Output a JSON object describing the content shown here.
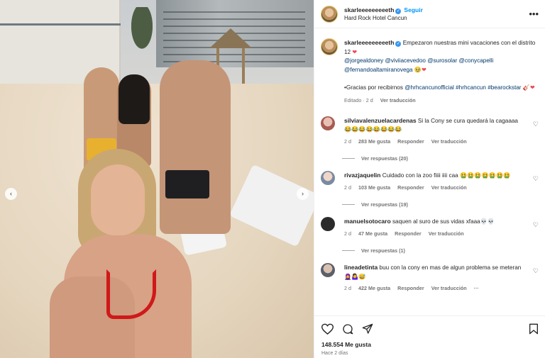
{
  "post": {
    "username": "skarleeeeeeeeeth",
    "follow_label": "Seguir",
    "location": "Hard Rock Hotel Cancun",
    "caption": {
      "p1": "Empezaron nuestras mini vacaciones con el distrito 12",
      "mentions": [
        "@jorgealdoney",
        "@viviiacevedoo",
        "@surosolar",
        "@conycapelli",
        "@fernandoaltamiranovega"
      ],
      "p2": "•Gracias por recibirnos",
      "p2_mentions": [
        "@hrhcancunofficial",
        "#hrhcancun",
        "#bearockstar"
      ],
      "time": "Editado · 2 d",
      "see_translation": "Ver traducción"
    },
    "likes": "148.554 Me gusta",
    "posted_ago": "Hace 2 días"
  },
  "comments": [
    {
      "user": "silviavalenzuelacardenas",
      "text": "Si la Cony se cura quedará la cagaaaa",
      "emoji": "😂😂😂😂😂😂😂😂",
      "time": "2 d",
      "likes": "283 Me gusta",
      "reply": "Responder",
      "translate": "Ver traducción",
      "replies": "Ver respuestas (20)"
    },
    {
      "user": "rivazjaquelin",
      "text": "Cuidado con la zoo fiiii iiii caa",
      "emoji": "🤮🤮🤮🤮🤮🤮🤮",
      "time": "2 d",
      "likes": "103 Me gusta",
      "reply": "Responder",
      "translate": "Ver traducción",
      "replies": "Ver respuestas (19)"
    },
    {
      "user": "manuelsotocaro",
      "text": "saquen al suro de sus vidas xfaaa💀💀",
      "time": "2 d",
      "likes": "47 Me gusta",
      "reply": "Responder",
      "translate": "Ver traducción",
      "replies": "Ver respuestas (1)"
    },
    {
      "user": "lineadetinta",
      "text": "buu con la cony en mas de algun problema se meteran",
      "emoji": "🧕🤷‍♀️😅",
      "time": "2 d",
      "likes": "422 Me gusta",
      "reply": "Responder",
      "translate": "Ver traducción",
      "more": "···"
    }
  ],
  "icons": {
    "heart": "heart-icon",
    "comment": "comment-icon",
    "share": "share-icon",
    "bookmark": "bookmark-icon",
    "more": "more-options-icon",
    "verified": "verified-badge-icon"
  },
  "colors": {
    "accent": "#0095f6",
    "link": "#00376b",
    "heart": "#ed4956",
    "muted": "#737373"
  }
}
